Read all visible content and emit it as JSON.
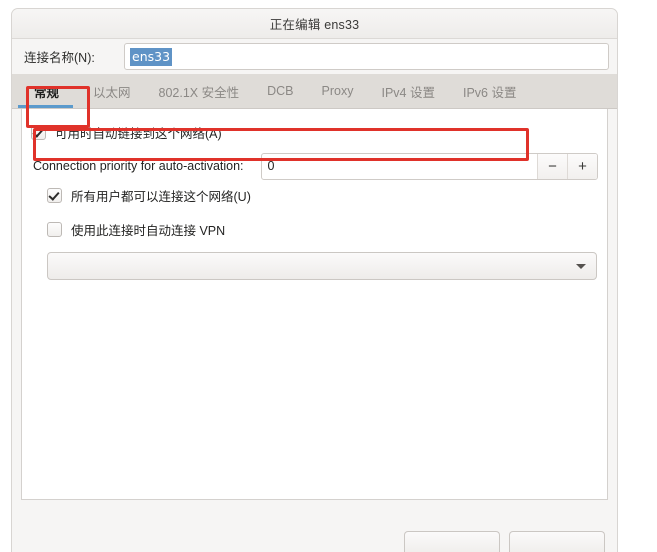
{
  "window": {
    "title": "正在编辑 ens33"
  },
  "connection_name": {
    "label": "连接名称(N):",
    "value": "ens33",
    "placeholder": ""
  },
  "tabs": [
    {
      "label": "常规",
      "active": true
    },
    {
      "label": "以太网",
      "active": false
    },
    {
      "label": "802.1X 安全性",
      "active": false
    },
    {
      "label": "DCB",
      "active": false
    },
    {
      "label": "Proxy",
      "active": false
    },
    {
      "label": "IPv4 设置",
      "active": false
    },
    {
      "label": "IPv6 设置",
      "active": false
    }
  ],
  "general": {
    "autoconnect": {
      "label": "可用时自动链接到这个网络(A)",
      "checked": true
    },
    "priority": {
      "label": "Connection priority for auto-activation:",
      "value": "0",
      "decrement_label": "−",
      "increment_label": "+"
    },
    "all_users": {
      "label": "所有用户都可以连接这个网络(U)",
      "checked": true
    },
    "auto_vpn": {
      "label": "使用此连接时自动连接 VPN",
      "checked": false
    },
    "vpn_select": {
      "value": "",
      "icon": "chevron-down-icon"
    }
  },
  "actions": {
    "cancel_label": "",
    "save_label": ""
  },
  "annotations": {
    "color": "#e0322a",
    "boxes": [
      {
        "name": "general-tab-highlight"
      },
      {
        "name": "autoconnect-row-highlight"
      }
    ]
  },
  "colors": {
    "accent_tab_underline": "#5b9acc",
    "selection_blue": "#5f93c6",
    "annotation_red": "#e0322a",
    "window_bg": "#f6f5f4",
    "tabbar_bg": "#dfdcd8"
  }
}
